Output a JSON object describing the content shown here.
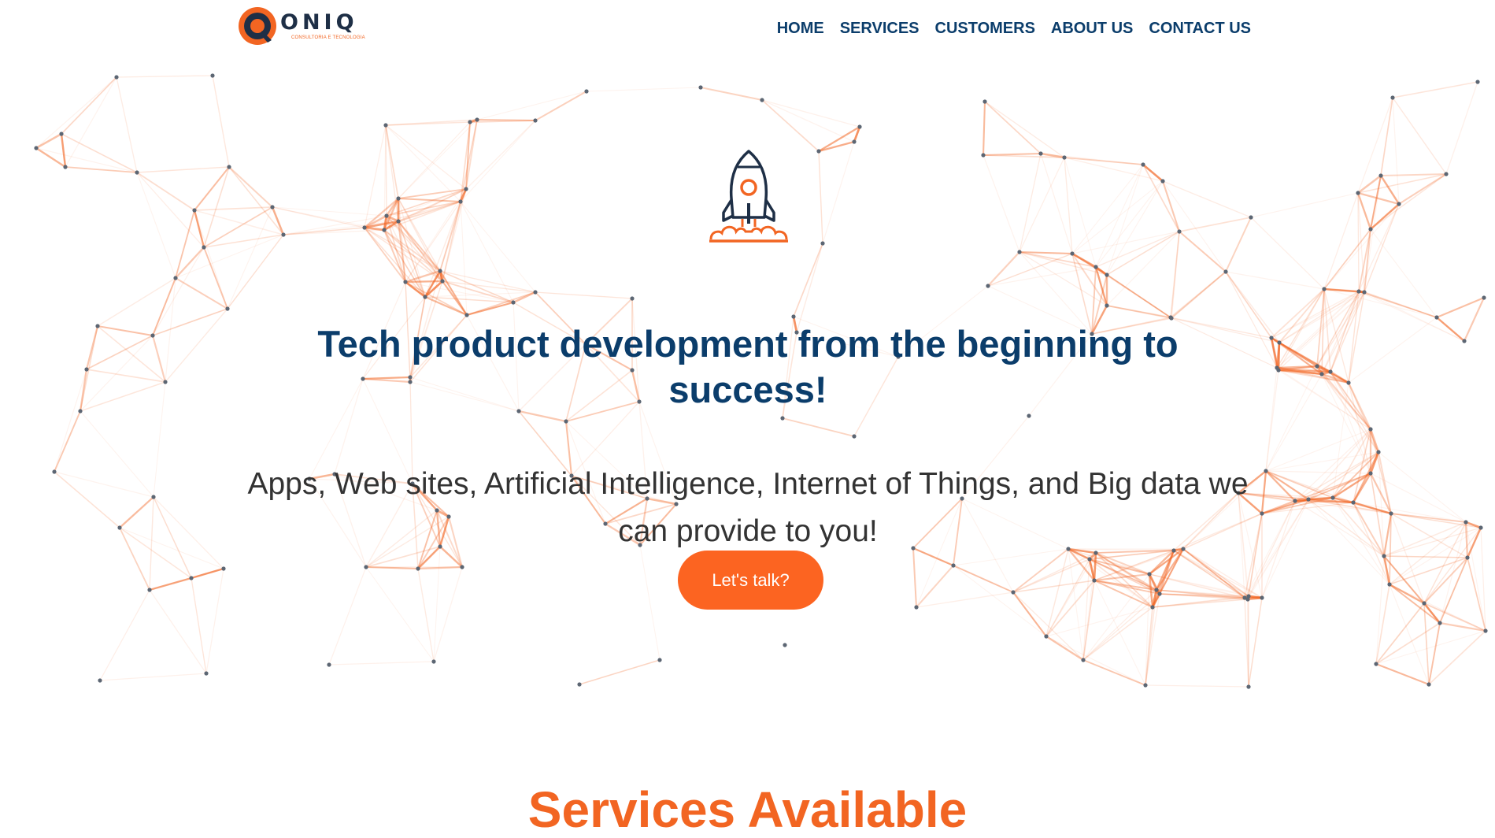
{
  "brand": {
    "name": "ONIQ",
    "tagline": "CONSULTORIA E TECNOLOGIA",
    "colors": {
      "navy": "#1e2f46",
      "orange": "#f26522"
    }
  },
  "nav": {
    "items": [
      {
        "label": "HOME"
      },
      {
        "label": "SERVICES"
      },
      {
        "label": "CUSTOMERS"
      },
      {
        "label": "ABOUT US"
      },
      {
        "label": "CONTACT US"
      }
    ]
  },
  "hero": {
    "icon": "rocket-icon",
    "title": "Tech product development from the beginning to success!",
    "subtitle": "Apps, Web sites, Artificial Intelligence, Internet of Things, and Big data we can provide to you!",
    "cta_label": "Let's talk?"
  },
  "services": {
    "heading": "Services Available"
  },
  "theme": {
    "heading_color": "#0b3d6b",
    "accent": "#fc6421",
    "text_color": "#333333",
    "background": "#ffffff"
  }
}
